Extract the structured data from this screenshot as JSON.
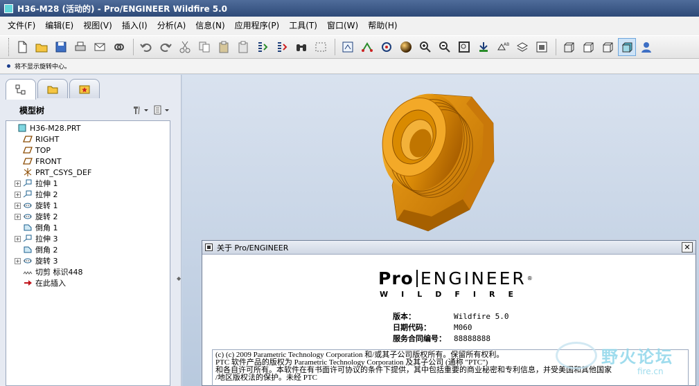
{
  "window": {
    "title": "H36-M28 (活动的) - Pro/ENGINEER Wildfire 5.0"
  },
  "menubar": {
    "items": [
      "文件(F)",
      "编辑(E)",
      "视图(V)",
      "插入(I)",
      "分析(A)",
      "信息(N)",
      "应用程序(P)",
      "工具(T)",
      "窗口(W)",
      "帮助(H)"
    ]
  },
  "status": {
    "message": "将不显示旋转中心。"
  },
  "navigator": {
    "title": "模型树"
  },
  "model_tree": {
    "items": [
      {
        "label": "H36-M28.PRT",
        "icon": "part-icon",
        "expandable": false,
        "indent": 0
      },
      {
        "label": "RIGHT",
        "icon": "datum-plane-icon",
        "expandable": false,
        "indent": 1
      },
      {
        "label": "TOP",
        "icon": "datum-plane-icon",
        "expandable": false,
        "indent": 1
      },
      {
        "label": "FRONT",
        "icon": "datum-plane-icon",
        "expandable": false,
        "indent": 1
      },
      {
        "label": "PRT_CSYS_DEF",
        "icon": "csys-icon",
        "expandable": false,
        "indent": 1
      },
      {
        "label": "拉伸 1",
        "icon": "extrude-icon",
        "expandable": true,
        "indent": 1
      },
      {
        "label": "拉伸 2",
        "icon": "extrude-icon",
        "expandable": true,
        "indent": 1
      },
      {
        "label": "旋转 1",
        "icon": "revolve-icon",
        "expandable": true,
        "indent": 1
      },
      {
        "label": "旋转 2",
        "icon": "revolve-icon",
        "expandable": true,
        "indent": 1
      },
      {
        "label": "倒角 1",
        "icon": "chamfer-icon",
        "expandable": false,
        "indent": 1
      },
      {
        "label": "拉伸 3",
        "icon": "extrude-icon",
        "expandable": true,
        "indent": 1
      },
      {
        "label": "倒角 2",
        "icon": "chamfer-icon",
        "expandable": false,
        "indent": 1
      },
      {
        "label": "旋转 3",
        "icon": "revolve-icon",
        "expandable": true,
        "indent": 1
      },
      {
        "label": "切剪 标识448",
        "icon": "cut-icon",
        "expandable": false,
        "indent": 1
      },
      {
        "label": "在此插入",
        "icon": "insert-here-icon",
        "expandable": false,
        "indent": 1
      }
    ]
  },
  "about_dialog": {
    "title": "关于 Pro/ENGINEER",
    "close_label": "✕",
    "logo_pro": "Pro",
    "logo_engineer": "ENGINEER",
    "logo_reg": "®",
    "logo_sub": "WILDFIRE",
    "version_label": "版本：",
    "version_value": "Wildfire 5.0",
    "date_label": "日期代码：",
    "date_value": "M060",
    "contract_label": "服务合同编号：",
    "contract_value": "88888888",
    "legal_lines": [
      "(c) (c) 2009 Parametric Technology Corporation 和/或其子公司版权所有。保留所有权利。",
      "PTC 软件产品的版权为 Parametric Technology Corporation 及其子公司 (通称 \"PTC\")",
      "和各自许可所有。本软件在有书面许可协议的条件下提供，其中包括重要的商业秘密和专利信息，并受美国和其他国家",
      "/地区版权法的保护。未经 PTC"
    ]
  },
  "watermark": {
    "text": "野火论坛",
    "url": "fire.cn"
  },
  "colors": {
    "model": "#d98a00",
    "titlebar": "#3a5785",
    "graphics_bg": "#c5d3e5"
  }
}
